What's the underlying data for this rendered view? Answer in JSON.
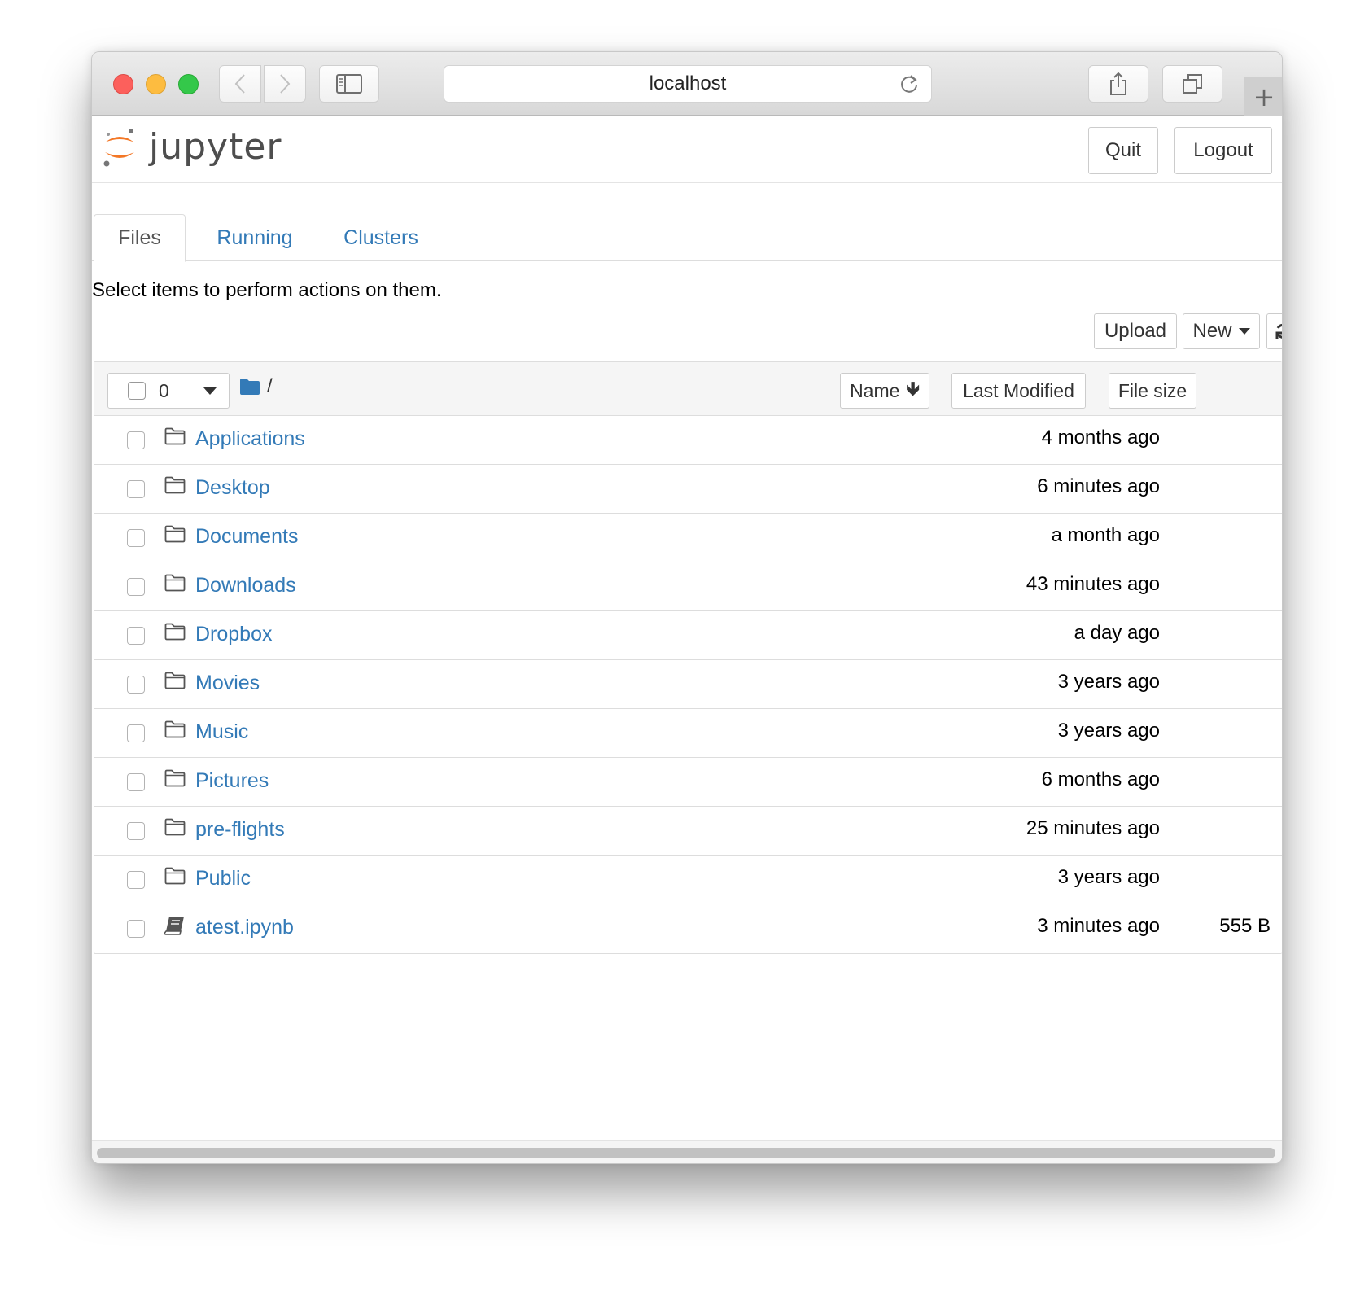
{
  "browser": {
    "address": "localhost"
  },
  "header": {
    "logo_text": "jupyter",
    "quit_label": "Quit",
    "logout_label": "Logout"
  },
  "tabs": [
    {
      "label": "Files",
      "active": true
    },
    {
      "label": "Running",
      "active": false
    },
    {
      "label": "Clusters",
      "active": false
    }
  ],
  "toolbar": {
    "hint": "Select items to perform actions on them.",
    "upload_label": "Upload",
    "new_label": "New"
  },
  "list_header": {
    "selected_count": "0",
    "path": "/",
    "sort_name": "Name",
    "sort_name_arrow": "🡻",
    "sort_modified": "Last Modified",
    "sort_size": "File size"
  },
  "items": [
    {
      "name": "Applications",
      "type": "folder",
      "modified": "4 months ago",
      "size": ""
    },
    {
      "name": "Desktop",
      "type": "folder",
      "modified": "6 minutes ago",
      "size": ""
    },
    {
      "name": "Documents",
      "type": "folder",
      "modified": "a month ago",
      "size": ""
    },
    {
      "name": "Downloads",
      "type": "folder",
      "modified": "43 minutes ago",
      "size": ""
    },
    {
      "name": "Dropbox",
      "type": "folder",
      "modified": "a day ago",
      "size": ""
    },
    {
      "name": "Movies",
      "type": "folder",
      "modified": "3 years ago",
      "size": ""
    },
    {
      "name": "Music",
      "type": "folder",
      "modified": "3 years ago",
      "size": ""
    },
    {
      "name": "Pictures",
      "type": "folder",
      "modified": "6 months ago",
      "size": ""
    },
    {
      "name": "pre-flights",
      "type": "folder",
      "modified": "25 minutes ago",
      "size": ""
    },
    {
      "name": "Public",
      "type": "folder",
      "modified": "3 years ago",
      "size": ""
    },
    {
      "name": "atest.ipynb",
      "type": "notebook",
      "modified": "3 minutes ago",
      "size": "555 B"
    }
  ],
  "colors": {
    "link": "#337ab7",
    "jupyter_orange": "#f37726",
    "traffic_red": "#fc605c",
    "traffic_yellow": "#fdbc40",
    "traffic_green": "#34c84a"
  }
}
